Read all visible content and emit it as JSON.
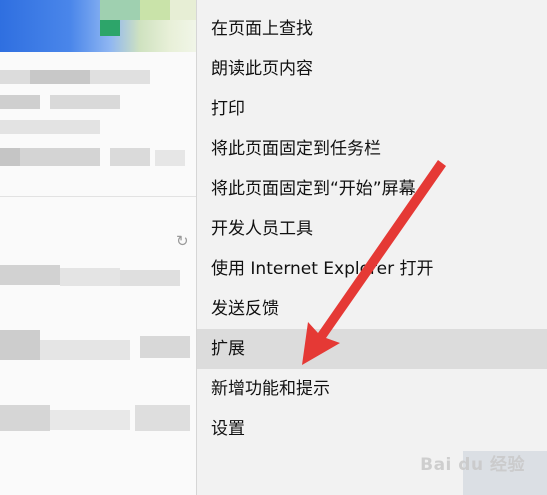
{
  "menu": {
    "items": [
      {
        "label": "在页面上查找"
      },
      {
        "label": "朗读此页内容"
      },
      {
        "label": "打印"
      },
      {
        "label": "将此页面固定到任务栏"
      },
      {
        "label": "将此页面固定到“开始”屏幕"
      },
      {
        "label": "开发人员工具"
      },
      {
        "label": "使用 Internet Explorer 打开"
      },
      {
        "label": "发送反馈"
      },
      {
        "label": "扩展"
      },
      {
        "label": "新增功能和提示"
      },
      {
        "label": "设置"
      }
    ],
    "hovered_index": 8
  },
  "annotation": {
    "arrow_color": "#e53935"
  },
  "watermark": {
    "text": "Bai du 经验"
  },
  "colors": {
    "menu_bg": "#f2f2f2",
    "hover_bg": "#dcdcdc"
  }
}
